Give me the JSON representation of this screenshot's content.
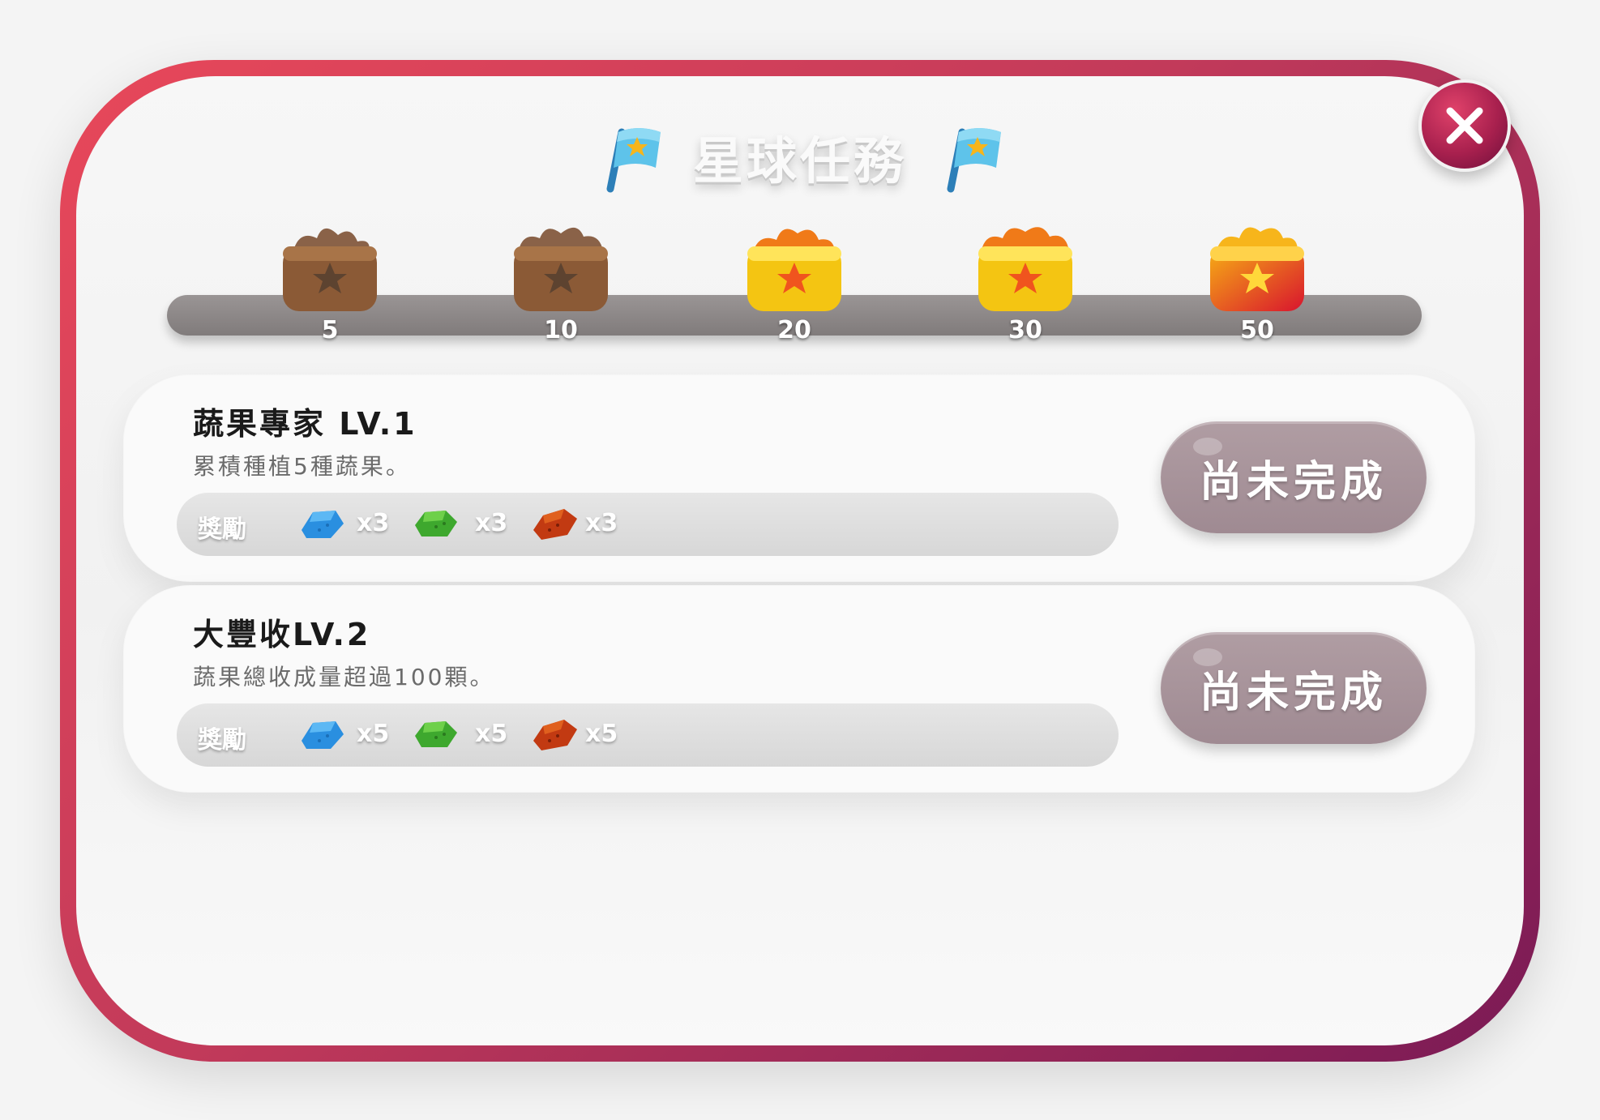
{
  "title": "星球任務",
  "milestones": [
    {
      "label": "5",
      "state": "locked"
    },
    {
      "label": "10",
      "state": "locked"
    },
    {
      "label": "20",
      "state": "gold"
    },
    {
      "label": "30",
      "state": "gold"
    },
    {
      "label": "50",
      "state": "red-gold"
    }
  ],
  "reward_label": "獎勵",
  "tasks": [
    {
      "title": "蔬果專家 LV.1",
      "description": "累積種植5種蔬果。",
      "rewards": [
        {
          "gem": "blue-gem-icon",
          "count": "x3"
        },
        {
          "gem": "green-gem-icon",
          "count": "x3"
        },
        {
          "gem": "red-gem-icon",
          "count": "x3"
        }
      ],
      "status": "尚未完成"
    },
    {
      "title": "大豐收LV.2",
      "description": "蔬果總收成量超過100顆。",
      "rewards": [
        {
          "gem": "blue-gem-icon",
          "count": "x5"
        },
        {
          "gem": "green-gem-icon",
          "count": "x5"
        },
        {
          "gem": "red-gem-icon",
          "count": "x5"
        }
      ],
      "status": "尚未完成"
    }
  ],
  "colors": {
    "frame_start": "#e8485a",
    "frame_end": "#7a1a55",
    "status_button": "#a8949b",
    "close_button": "#a8204e"
  },
  "icons": {
    "close": "close-icon",
    "flag": "flag-icon"
  }
}
